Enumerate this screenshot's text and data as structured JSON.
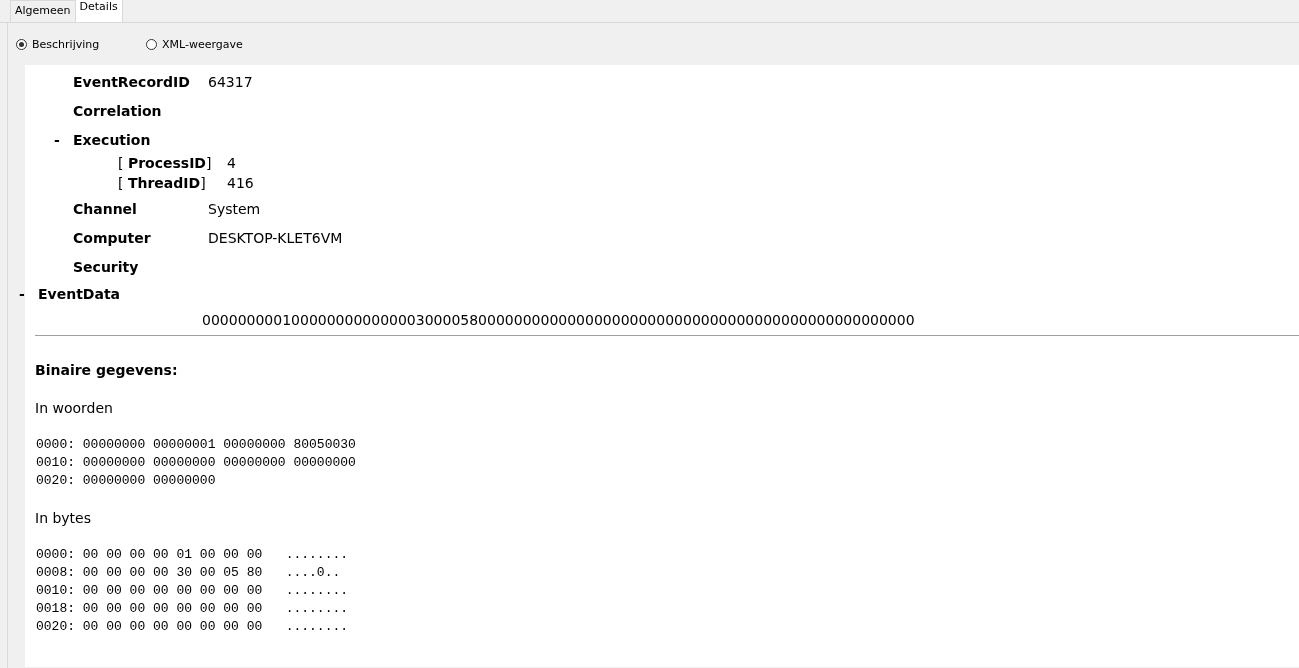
{
  "tabs": [
    {
      "label": "Algemeen",
      "selected": false
    },
    {
      "label": "Details",
      "selected": true
    }
  ],
  "view_options": [
    {
      "label": "Beschrijving",
      "selected": true
    },
    {
      "label": "XML-weergave",
      "selected": false
    }
  ],
  "system_fields": [
    {
      "kind": "field",
      "label": "EventRecordID",
      "value": "64317"
    },
    {
      "kind": "field",
      "label": "Correlation"
    },
    {
      "kind": "group",
      "label": "Execution",
      "toggle": "-",
      "children": [
        {
          "label": "[ **ProcessID**]",
          "value": "4"
        },
        {
          "label": "[ **ThreadID**]",
          "value": "416"
        }
      ]
    },
    {
      "kind": "field",
      "label": "Channel",
      "value": "System"
    },
    {
      "kind": "field",
      "label": "Computer",
      "value": "DESKTOP-KLET6VM"
    },
    {
      "kind": "field",
      "label": "Security"
    }
  ],
  "event_data": {
    "label": "EventData",
    "toggle": "-",
    "value": "00000000010000000000000030000580000000000000000000000000000000000000000000000000"
  },
  "binary": {
    "title": "Binaire gegevens:",
    "words_title": "In woorden",
    "words": [
      "0000: 00000000 00000001 00000000 80050030",
      "0010: 00000000 00000000 00000000 00000000",
      "0020: 00000000 00000000"
    ],
    "bytes_title": "In bytes",
    "bytes": [
      "0000: 00 00 00 00 01 00 00 00   ........",
      "0008: 00 00 00 00 30 00 05 80   ....0..",
      "0010: 00 00 00 00 00 00 00 00   ........",
      "0018: 00 00 00 00 00 00 00 00   ........",
      "0020: 00 00 00 00 00 00 00 00   ........"
    ]
  }
}
